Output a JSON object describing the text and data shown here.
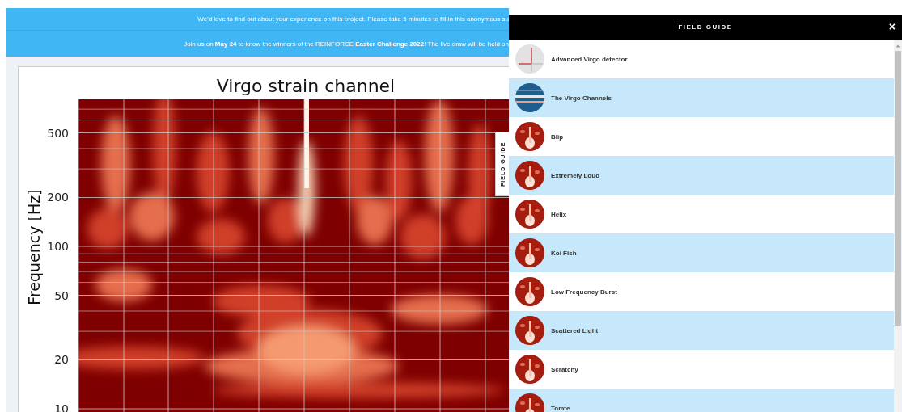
{
  "banners": [
    {
      "text": "We'd love to find out about your experience on this project. Please take 5 minutes to fill in this anonymous su"
    },
    {
      "text": "Join us on **May 24** to know the winners of the REINFORCE **Easter Challenge 2022**! The live draw will be held on"
    }
  ],
  "spectrogram": {
    "title": "Virgo strain channel",
    "ylabel": "Frequency [Hz]",
    "yticks": [
      "500",
      "200",
      "100",
      "50",
      "20",
      "10"
    ]
  },
  "field_guide_tab": {
    "label": "FIELD GUIDE"
  },
  "field_guide": {
    "title": "FIELD GUIDE",
    "close": "×",
    "items": [
      {
        "label": "Advanced Virgo detector",
        "kind": "diagram"
      },
      {
        "label": "The Virgo Channels",
        "kind": "channels"
      },
      {
        "label": "Blip",
        "kind": "spectrogram"
      },
      {
        "label": "Extremely Loud",
        "kind": "spectrogram"
      },
      {
        "label": "Helix",
        "kind": "spectrogram"
      },
      {
        "label": "Koi Fish",
        "kind": "spectrogram"
      },
      {
        "label": "Low Frequency Burst",
        "kind": "spectrogram"
      },
      {
        "label": "Scattered Light",
        "kind": "spectrogram"
      },
      {
        "label": "Scratchy",
        "kind": "spectrogram"
      },
      {
        "label": "Tomte",
        "kind": "spectrogram"
      }
    ]
  }
}
